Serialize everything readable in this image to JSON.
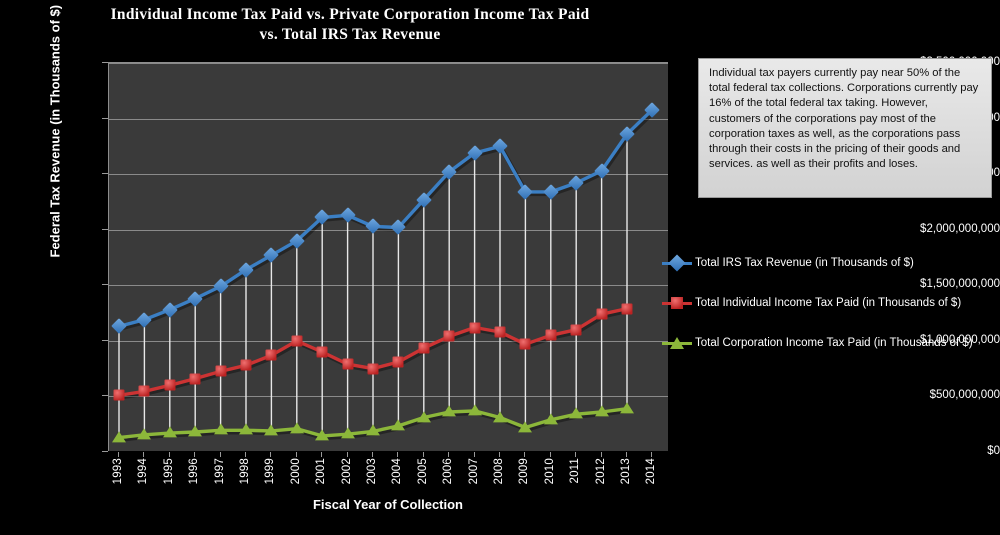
{
  "title": {
    "line1": "Individual  Income Tax Paid  vs. Private Corporation Income Tax Paid",
    "line2": "vs.  Total  IRS  Tax Revenue"
  },
  "axes": {
    "y_title": "Federal Tax Revenue (in Thousands of $)",
    "x_title": "Fiscal Year of Collection",
    "y_ticks": [
      "$0",
      "$500,000,000",
      "$1,000,000,000",
      "$1,500,000,000",
      "$2,000,000,000",
      "$2,500,000,000",
      "$3,000,000,000",
      "$3,500,000,000"
    ]
  },
  "legend": {
    "items": [
      {
        "label": "Total IRS Tax Revenue (in Thousands of $)",
        "color": "#3b7fc4",
        "marker": "diamond-marker-icon"
      },
      {
        "label": "Total Individual  Income Tax Paid (in Thousands of $)",
        "color": "#cc3333",
        "marker": "square-marker-icon"
      },
      {
        "label": "Total Corporation   Income Tax Paid (in Thousands of $)",
        "color": "#8cb73a",
        "marker": "triangle-marker-icon"
      }
    ]
  },
  "annotation": {
    "text": "Individual  tax payers  currently pay  near 50% of the total  federal tax  collections.   Corporations currently pay 16% of the total  federal tax taking.  However,  customers  of the corporations  pay most of the  corporation taxes as well, as the corporations pass through their costs in the pricing of their goods and  services. as  well as their profits and loses."
  },
  "chart_data": {
    "type": "line",
    "title": "Individual  Income Tax Paid  vs. Private Corporation Income Tax Paid vs.  Total  IRS  Tax Revenue",
    "xlabel": "Fiscal Year of Collection",
    "ylabel": "Federal Tax Revenue (in Thousands of $)",
    "ylim": [
      0,
      3500000000
    ],
    "ytick_step": 500000000,
    "grid": true,
    "legend_position": "right",
    "drop_lines": true,
    "plot_background": "#3a3a3a",
    "page_background": "#000000",
    "categories": [
      1993,
      1994,
      1995,
      1996,
      1997,
      1998,
      1999,
      2000,
      2001,
      2002,
      2003,
      2004,
      2005,
      2006,
      2007,
      2008,
      2009,
      2010,
      2011,
      2012,
      2013,
      2014
    ],
    "series": [
      {
        "name": "Total IRS Tax Revenue (in Thousands of $)",
        "color": "#3b7fc4",
        "marker": "diamond",
        "values": [
          1130000000,
          1190000000,
          1280000000,
          1380000000,
          1490000000,
          1640000000,
          1770000000,
          1900000000,
          2110000000,
          2130000000,
          2030000000,
          2020000000,
          2270000000,
          2520000000,
          2690000000,
          2750000000,
          2340000000,
          2340000000,
          2420000000,
          2530000000,
          2860000000,
          3080000000
        ]
      },
      {
        "name": "Total Individual  Income Tax Paid (in Thousands of $)",
        "color": "#cc3333",
        "marker": "square",
        "values": [
          510000000,
          545000000,
          600000000,
          660000000,
          725000000,
          780000000,
          870000000,
          1000000000,
          900000000,
          790000000,
          750000000,
          810000000,
          935000000,
          1040000000,
          1120000000,
          1080000000,
          970000000,
          1050000000,
          1100000000,
          1240000000,
          1290000000,
          null
        ]
      },
      {
        "name": "Total Corporation   Income Tax Paid (in Thousands of $)",
        "color": "#8cb73a",
        "marker": "triangle",
        "values": [
          130000000,
          155000000,
          170000000,
          180000000,
          195000000,
          195000000,
          190000000,
          210000000,
          145000000,
          160000000,
          185000000,
          235000000,
          310000000,
          360000000,
          370000000,
          310000000,
          220000000,
          290000000,
          340000000,
          360000000,
          390000000,
          null
        ]
      }
    ]
  }
}
